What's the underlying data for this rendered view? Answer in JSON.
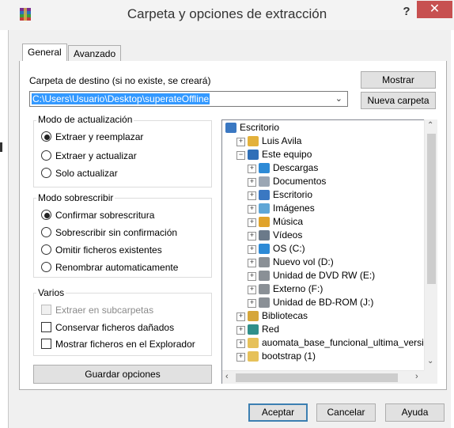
{
  "window": {
    "title": "Carpeta y opciones de extracción",
    "help_glyph": "?",
    "close_glyph": "✕"
  },
  "tabs": [
    {
      "label": "General",
      "active": true
    },
    {
      "label": "Avanzado",
      "active": false
    }
  ],
  "destination": {
    "label": "Carpeta de destino (si no existe, se creará)",
    "value": "C:\\Users\\Usuario\\Desktop\\superateOffline",
    "show_button": "Mostrar",
    "new_folder_button": "Nueva carpeta"
  },
  "update_mode": {
    "title": "Modo de actualización",
    "options": [
      {
        "label": "Extraer y reemplazar",
        "selected": true
      },
      {
        "label": "Extraer y actualizar",
        "selected": false
      },
      {
        "label": "Solo actualizar",
        "selected": false
      }
    ]
  },
  "overwrite_mode": {
    "title": "Modo sobrescribir",
    "options": [
      {
        "label": "Confirmar sobrescritura",
        "selected": true
      },
      {
        "label": "Sobrescribir sin confirmación",
        "selected": false
      },
      {
        "label": "Omitir ficheros existentes",
        "selected": false
      },
      {
        "label": "Renombrar automaticamente",
        "selected": false
      }
    ]
  },
  "misc": {
    "title": "Varios",
    "options": [
      {
        "label": "Extraer en subcarpetas",
        "checked": false,
        "disabled": true
      },
      {
        "label": "Conservar ficheros dañados",
        "checked": false,
        "disabled": false
      },
      {
        "label": "Mostrar ficheros en el Explorador",
        "checked": false,
        "disabled": false
      }
    ]
  },
  "save_button": "Guardar opciones",
  "tree": {
    "items": [
      {
        "label": "Escritorio",
        "indent": 0,
        "expander": "",
        "icon": "desktop-icon"
      },
      {
        "label": "Luis Avila",
        "indent": 1,
        "expander": "+",
        "icon": "user-folder-icon"
      },
      {
        "label": "Este equipo",
        "indent": 1,
        "expander": "−",
        "icon": "computer-icon"
      },
      {
        "label": "Descargas",
        "indent": 2,
        "expander": "+",
        "icon": "downloads-icon"
      },
      {
        "label": "Documentos",
        "indent": 2,
        "expander": "+",
        "icon": "documents-icon"
      },
      {
        "label": "Escritorio",
        "indent": 2,
        "expander": "+",
        "icon": "desktop-icon"
      },
      {
        "label": "Imágenes",
        "indent": 2,
        "expander": "+",
        "icon": "pictures-icon"
      },
      {
        "label": "Música",
        "indent": 2,
        "expander": "+",
        "icon": "music-icon"
      },
      {
        "label": "Vídeos",
        "indent": 2,
        "expander": "+",
        "icon": "videos-icon"
      },
      {
        "label": "OS (C:)",
        "indent": 2,
        "expander": "+",
        "icon": "windows-drive-icon"
      },
      {
        "label": "Nuevo vol (D:)",
        "indent": 2,
        "expander": "+",
        "icon": "drive-icon"
      },
      {
        "label": "Unidad de DVD RW (E:)",
        "indent": 2,
        "expander": "+",
        "icon": "dvd-drive-icon"
      },
      {
        "label": "Externo (F:)",
        "indent": 2,
        "expander": "+",
        "icon": "drive-icon"
      },
      {
        "label": "Unidad de BD-ROM (J:)",
        "indent": 2,
        "expander": "+",
        "icon": "dvd-drive-icon"
      },
      {
        "label": "Bibliotecas",
        "indent": 1,
        "expander": "+",
        "icon": "libraries-icon"
      },
      {
        "label": "Red",
        "indent": 1,
        "expander": "+",
        "icon": "network-icon"
      },
      {
        "label": "auomata_base_funcional_ultima_versic",
        "indent": 1,
        "expander": "+",
        "icon": "folder-icon"
      },
      {
        "label": "bootstrap (1)",
        "indent": 1,
        "expander": "+",
        "icon": "folder-icon"
      }
    ]
  },
  "footer": {
    "accept": "Aceptar",
    "cancel": "Cancelar",
    "help": "Ayuda"
  },
  "colors": {
    "selection": "#3399ff",
    "close_button": "#c75050"
  }
}
